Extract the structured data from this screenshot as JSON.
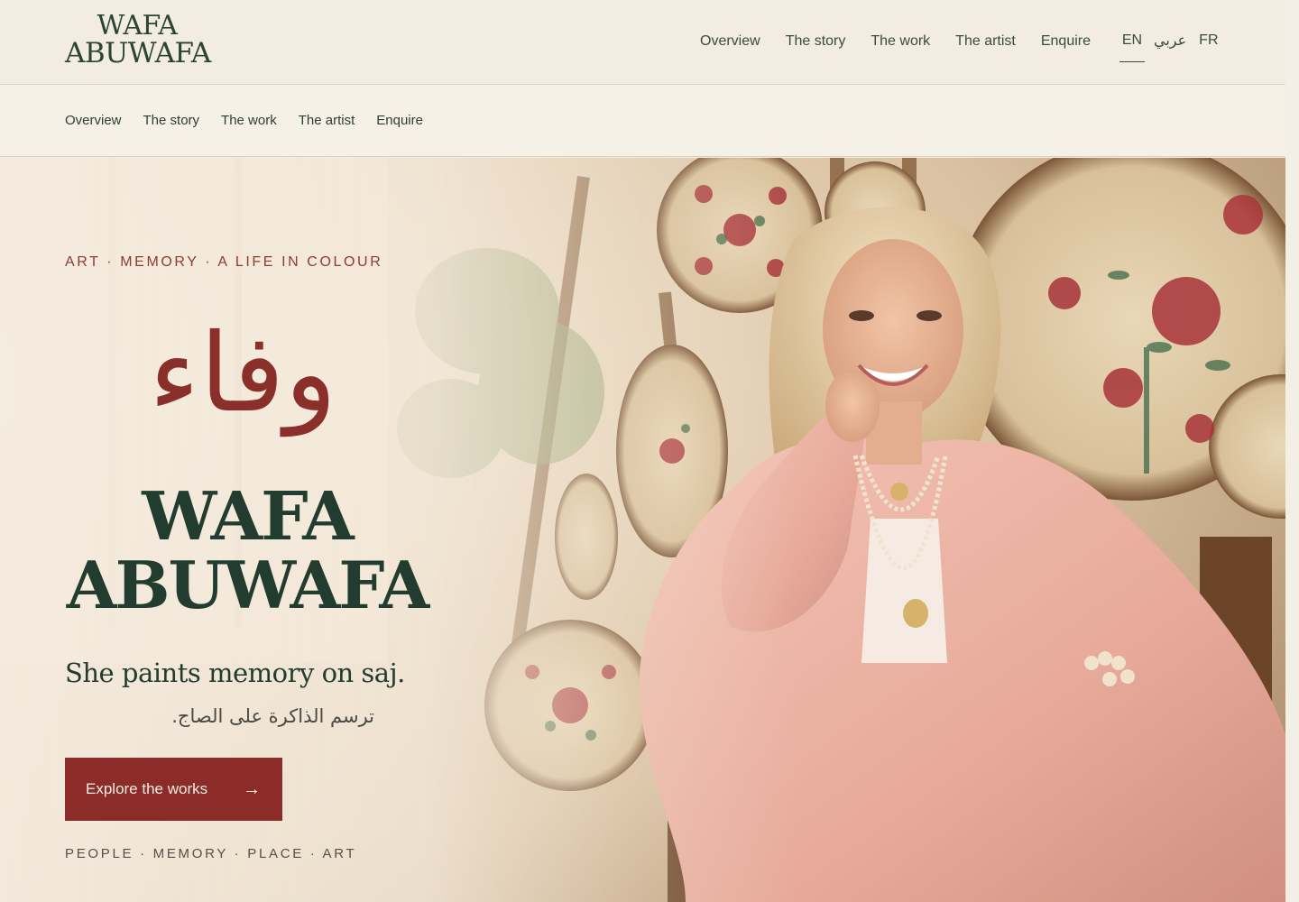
{
  "header": {
    "logo_line1": "WAFA",
    "logo_line2": "ABUWAFA",
    "nav": [
      "Overview",
      "The story",
      "The work",
      "The artist",
      "Enquire"
    ],
    "languages": {
      "en": "EN",
      "ar": "عربي",
      "fr": "FR",
      "active": "EN"
    }
  },
  "subnav": [
    "Overview",
    "The story",
    "The work",
    "The artist",
    "Enquire"
  ],
  "hero": {
    "eyebrow": "ART · MEMORY · A LIFE IN COLOUR",
    "arabic_name": "وفاء",
    "name_line1": "WAFA",
    "name_line2": "ABUWAFA",
    "tagline": "She paints memory on saj.",
    "tagline_ar": "ترسم الذاكرة على الصاج.",
    "cta_label": "Explore the works",
    "cta_icon": "arrow-right-icon",
    "bottom_line": "PEOPLE · MEMORY · PLACE · ART"
  },
  "colors": {
    "accent": "#8c2c28",
    "brand_green": "#223d2f",
    "background": "#f2ece1"
  }
}
